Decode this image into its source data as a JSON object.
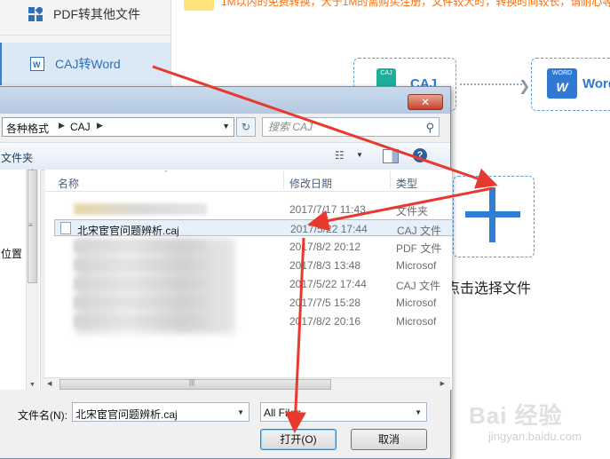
{
  "app": {
    "sidebar": {
      "items": [
        {
          "label": "PDF转其他文件"
        },
        {
          "label": "CAJ转Word"
        }
      ]
    },
    "notice": "1M以内的免费转换，大于1M的需购买注册，文件较大时，转换时间较长，请耐心等",
    "flow": {
      "source_badge": "CAJ",
      "source_label": "CAJ",
      "target_badge": "WORD",
      "target_letter": "W",
      "target_label": "Word"
    },
    "add_file_label": "点击选择文件",
    "watermark": {
      "main": "Bai 经验",
      "sub": "jingyan.baidu.com"
    }
  },
  "dialog": {
    "close_label": "✕",
    "breadcrumb": [
      "各种格式",
      "CAJ"
    ],
    "search_placeholder": "搜索 CAJ",
    "toolbar": {
      "organize": "文件夹"
    },
    "nav": {
      "location_label": "位置"
    },
    "columns": {
      "name": "名称",
      "date": "修改日期",
      "type": "类型"
    },
    "files": [
      {
        "name": "",
        "date": "2017/7/17 11:43",
        "type": "文件夹"
      },
      {
        "name": "北宋宦官问题辨析.caj",
        "date": "2017/5/22 17:44",
        "type": "CAJ 文件"
      },
      {
        "name": "",
        "date": "2017/8/2 20:12",
        "type": "PDF 文件"
      },
      {
        "name": "",
        "date": "2017/8/3 13:48",
        "type": "Microsof"
      },
      {
        "name": "",
        "date": "2017/5/22 17:44",
        "type": "CAJ 文件"
      },
      {
        "name": "",
        "date": "2017/7/5 15:28",
        "type": "Microsof"
      },
      {
        "name": "",
        "date": "2017/8/2 20:16",
        "type": "Microsof"
      }
    ],
    "filename_label": "文件名(N):",
    "filename_value": "北宋宦官问题辨析.caj",
    "filetype_value": "All Files",
    "open_button": "打开(O)",
    "cancel_button": "取消"
  },
  "colors": {
    "accent": "#2f78d4",
    "arrow": "#e8392f",
    "selection": "#e6f0fb"
  }
}
